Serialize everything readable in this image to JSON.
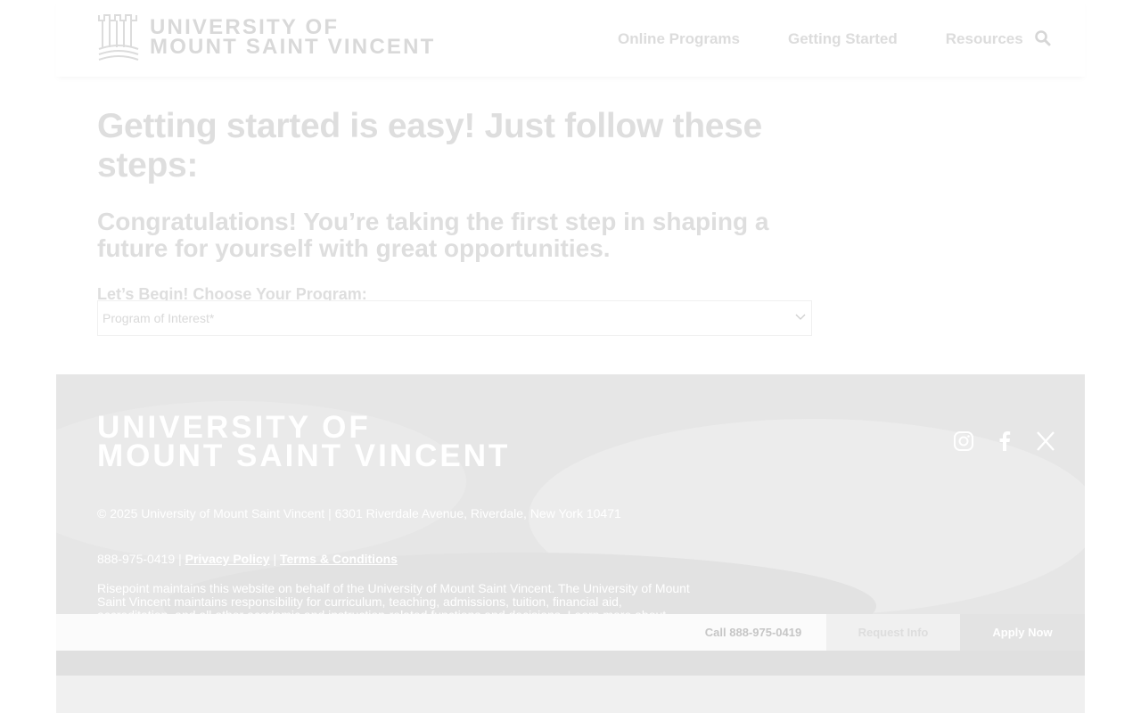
{
  "header": {
    "logo_line1": "UNIVERSITY OF",
    "logo_line2": "MOUNT SAINT VINCENT",
    "nav": [
      "Online Programs",
      "Getting Started",
      "Resources"
    ]
  },
  "main": {
    "title": "Getting started is easy! Just follow these steps:",
    "subtitle": "Congratulations! You’re taking the first step in shaping a future for yourself with great opportunities.",
    "prompt": "Let’s Begin! Choose Your Program:",
    "select_placeholder": "Program of Interest*"
  },
  "footer": {
    "logo_line1": "UNIVERSITY OF",
    "logo_line2": "MOUNT SAINT VINCENT",
    "copyright": "© 2025 University of Mount Saint Vincent | 6301 Riverdale Avenue, Riverdale, New York 10471",
    "phone": "888-975-0419",
    "separator": "|",
    "privacy": "Privacy Policy",
    "terms": "Terms & Conditions",
    "disclaimer": "Risepoint maintains this website on behalf of the University of Mount Saint Vincent. The University of Mount Saint Vincent maintains responsibility for curriculum, teaching, admissions, tuition, financial aid, accreditation, and all other academic and instruction-related functions and decisions. Learn more about"
  },
  "cta": {
    "call": "Call 888-975-0419",
    "request": "Request Info",
    "apply": "Apply Now"
  },
  "icons": {
    "logo": "castle-crest-icon",
    "search": "search-icon",
    "select": "chevron-down-icon",
    "social": [
      "instagram-icon",
      "facebook-icon",
      "x-icon"
    ]
  },
  "colors": {
    "footer_bg": "#e8e8e8",
    "text_faded": "#dedede",
    "apply_bg": "#e3e3e3"
  }
}
